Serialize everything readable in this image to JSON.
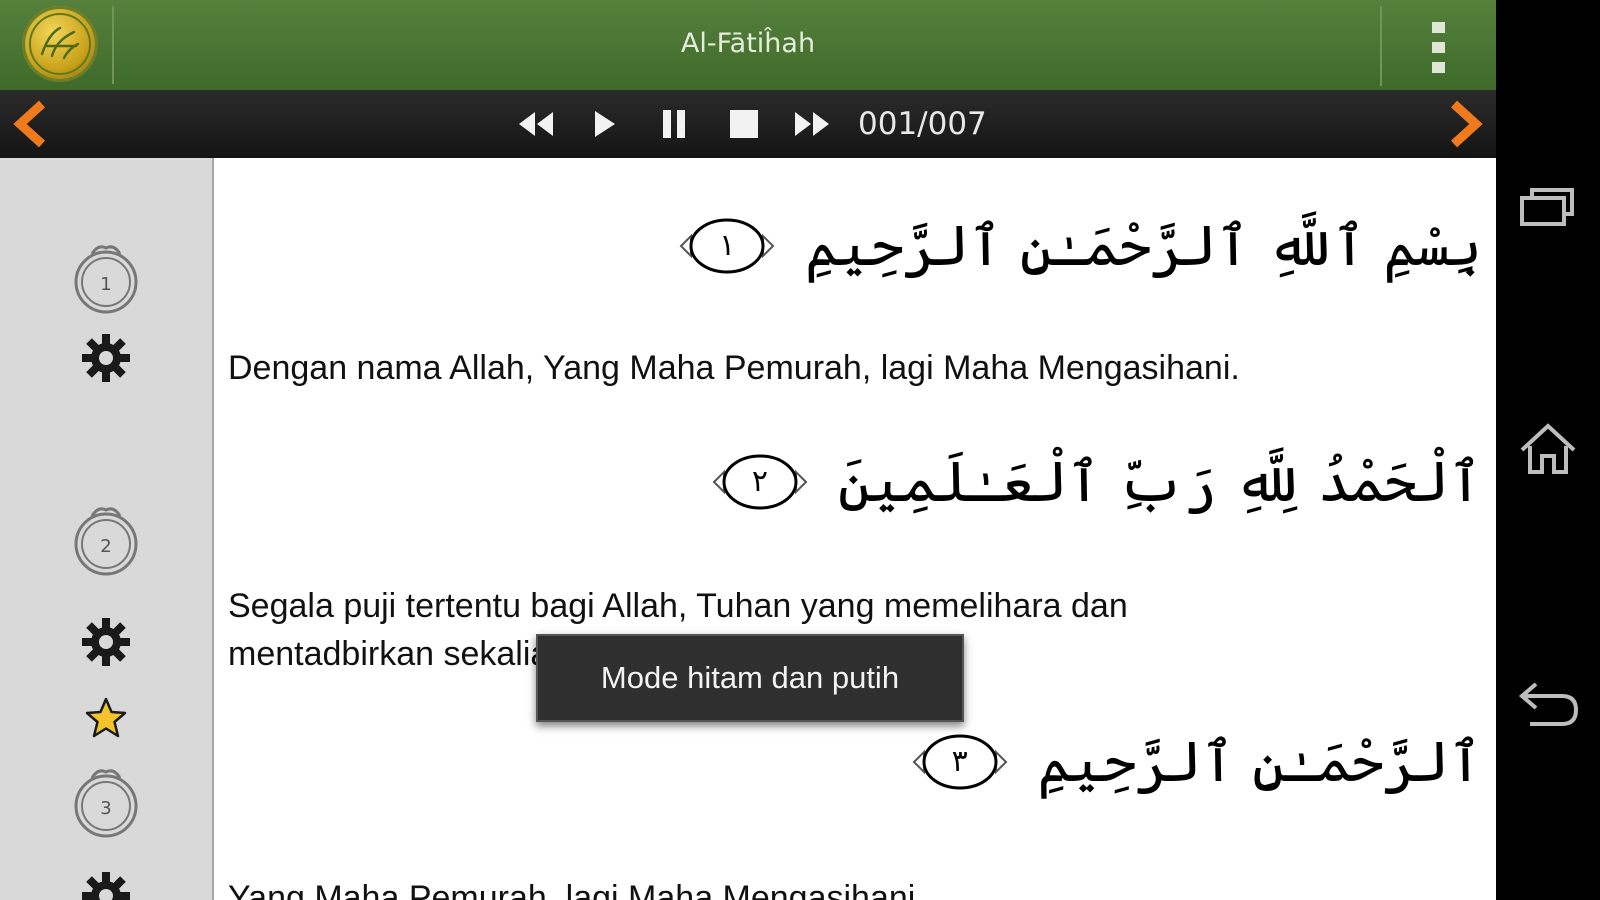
{
  "app": {
    "title": "Al-Fātiĥah",
    "logo_icon": "quran-logo-icon",
    "header_color": "#4a7534"
  },
  "player": {
    "counter": "001/007",
    "buttons": [
      "prev-surah-icon",
      "rewind-icon",
      "play-icon",
      "pause-icon",
      "stop-icon",
      "fast-forward-icon",
      "next-surah-icon"
    ],
    "accent": "#f07a1c"
  },
  "verses": [
    {
      "number": "1",
      "arabic": "بِسْمِ ٱللَّهِ ٱلرَّحْمَـٰنِ ٱلرَّحِيمِ",
      "ayah_mark": "١",
      "translation": "Dengan nama Allah, Yang Maha Pemurah, lagi Maha Mengasihani."
    },
    {
      "number": "2",
      "arabic": "ٱلْحَمْدُ لِلَّهِ رَبِّ ٱلْعَـٰلَمِينَ",
      "ayah_mark": "٢",
      "translation": "Segala puji tertentu bagi Allah, Tuhan yang memelihara dan mentadbirkan sekalian alam."
    },
    {
      "number": "3",
      "arabic": "ٱلرَّحْمَـٰنِ ٱلرَّحِيمِ",
      "ayah_mark": "٣",
      "translation": "Yang Maha Pemurah, lagi Maha Mengasihani.",
      "bookmarked": true
    }
  ],
  "toast": {
    "message": "Mode hitam dan putih"
  },
  "system_nav": [
    "recent-apps-icon",
    "home-icon",
    "back-icon"
  ]
}
